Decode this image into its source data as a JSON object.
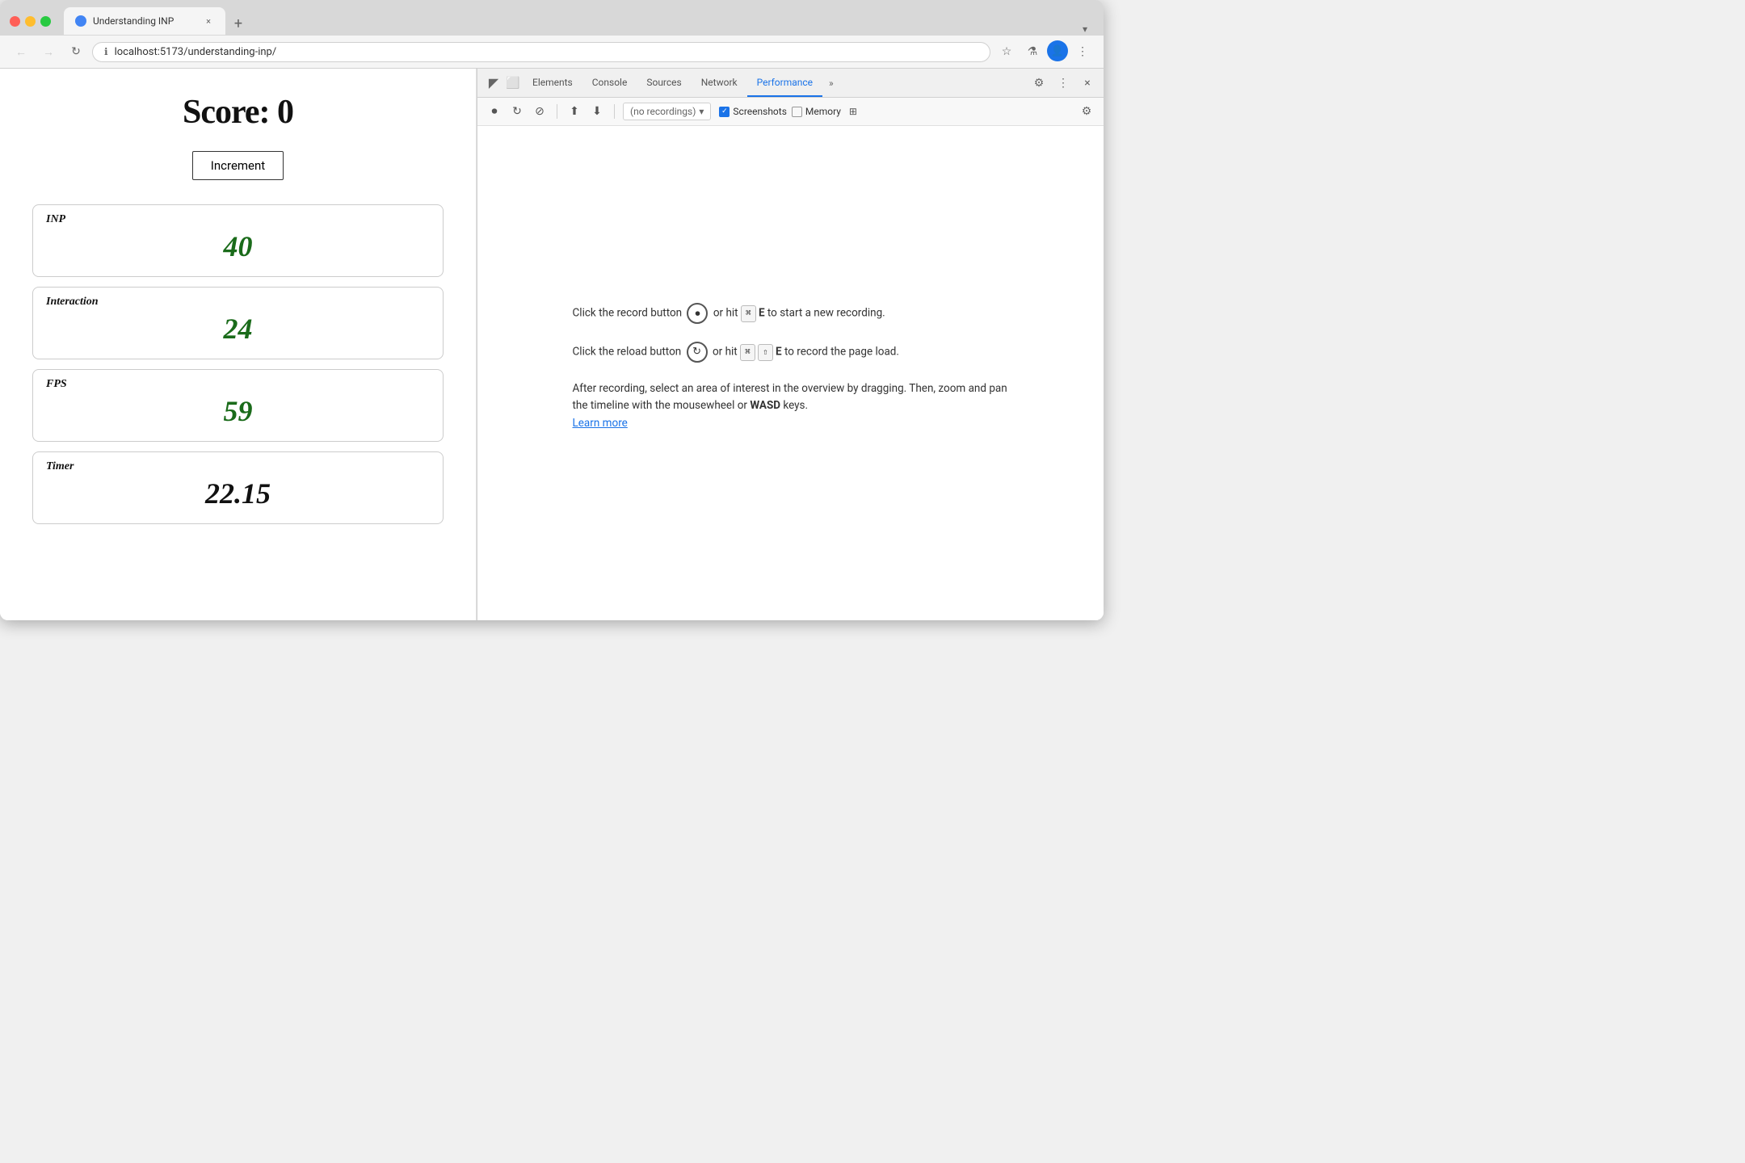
{
  "browser": {
    "traffic_lights": [
      "red",
      "yellow",
      "green"
    ],
    "tab": {
      "favicon": "globe",
      "title": "Understanding INP",
      "close_label": "×"
    },
    "new_tab_label": "+",
    "tab_chevron": "▾",
    "nav": {
      "back_label": "←",
      "forward_label": "→",
      "reload_label": "↻"
    },
    "address_bar": {
      "icon": "ℹ",
      "url": "localhost:5173/understanding-inp/"
    },
    "toolbar_actions": {
      "bookmark": "☆",
      "experiments": "⚗",
      "more": "⋮"
    },
    "profile": "👤"
  },
  "web_page": {
    "score_label": "Score:",
    "score_value": "0",
    "increment_button": "Increment",
    "metrics": [
      {
        "id": "inp",
        "label": "INP",
        "value": "40",
        "color": "#1a6b1a"
      },
      {
        "id": "interaction",
        "label": "Interaction",
        "value": "24",
        "color": "#1a6b1a"
      },
      {
        "id": "fps",
        "label": "FPS",
        "value": "59",
        "color": "#1a6b1a"
      },
      {
        "id": "timer",
        "label": "Timer",
        "value": "22.15",
        "color": "#111111"
      }
    ]
  },
  "devtools": {
    "tabs": [
      {
        "id": "elements",
        "label": "Elements",
        "active": false
      },
      {
        "id": "console",
        "label": "Console",
        "active": false
      },
      {
        "id": "sources",
        "label": "Sources",
        "active": false
      },
      {
        "id": "network",
        "label": "Network",
        "active": false
      },
      {
        "id": "performance",
        "label": "Performance",
        "active": true
      }
    ],
    "more_tabs": "»",
    "settings_icon": "⚙",
    "more_options_icon": "⋮",
    "close_icon": "×",
    "performance": {
      "record_btn": "⏺",
      "reload_btn": "↻",
      "clear_btn": "⊘",
      "upload_btn": "⬆",
      "download_btn": "⬇",
      "recordings_label": "(no recordings)",
      "screenshots_label": "Screenshots",
      "screenshots_checked": true,
      "memory_label": "Memory",
      "memory_checked": false,
      "capture_settings_icon": "⊞",
      "settings_icon": "⚙",
      "instructions": {
        "record_text_before": "Click the record button",
        "record_text_after": "or hit",
        "record_shortcut": "⌘ E",
        "record_text_end": "to start a new recording.",
        "reload_text_before": "Click the reload button",
        "reload_text_after": "or hit",
        "reload_shortcut": "⌘ ⇧ E",
        "reload_text_end": "to record the page load.",
        "after_text": "After recording, select an area of interest in the overview by dragging. Then, zoom and pan the timeline with the mousewheel or",
        "wasd_keys": "WASD",
        "after_text2": "keys.",
        "learn_more": "Learn more"
      }
    }
  }
}
